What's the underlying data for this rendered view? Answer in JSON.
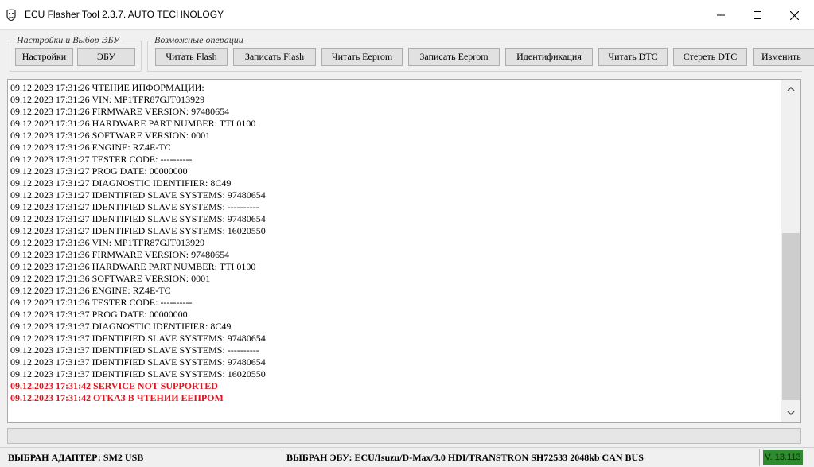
{
  "window": {
    "title": "ECU Flasher Tool 2.3.7. AUTO TECHNOLOGY"
  },
  "settings_group": {
    "legend": "Настройки и Выбор ЭБУ",
    "settings_label": "Настройки",
    "ecu_label": "ЭБУ"
  },
  "operations_group": {
    "legend": "Возможные операции",
    "buttons": [
      "Читать Flash",
      "Записать Flash",
      "Читать Eeprom",
      "Записать Eeprom",
      "Идентификация",
      "Читать DTC",
      "Стереть DTC",
      "Изменить"
    ]
  },
  "log": {
    "lines": [
      "09.12.2023 17:31:26 ЧТЕНИЕ ИНФОРМАЦИИ:",
      "09.12.2023 17:31:26 VIN: MP1TFR87GJT013929",
      "09.12.2023 17:31:26 FIRMWARE VERSION: 97480654",
      "09.12.2023 17:31:26 HARDWARE PART NUMBER: TTI  0100",
      "09.12.2023 17:31:26 SOFTWARE VERSION: 0001",
      "09.12.2023 17:31:26 ENGINE: RZ4E-TC",
      "09.12.2023 17:31:27 TESTER CODE: ----------",
      "09.12.2023 17:31:27 PROG DATE: 00000000",
      "09.12.2023 17:31:27 DIAGNOSTIC IDENTIFIER: 8C49",
      "09.12.2023 17:31:27 IDENTIFIED SLAVE SYSTEMS: 97480654",
      "09.12.2023 17:31:27 IDENTIFIED SLAVE SYSTEMS: ----------",
      "09.12.2023 17:31:27 IDENTIFIED SLAVE SYSTEMS: 97480654",
      "09.12.2023 17:31:27 IDENTIFIED SLAVE SYSTEMS: 16020550",
      "09.12.2023 17:31:36 VIN: MP1TFR87GJT013929",
      "09.12.2023 17:31:36 FIRMWARE VERSION: 97480654",
      "09.12.2023 17:31:36 HARDWARE PART NUMBER: TTI  0100",
      "09.12.2023 17:31:36 SOFTWARE VERSION: 0001",
      "09.12.2023 17:31:36 ENGINE: RZ4E-TC",
      "09.12.2023 17:31:36 TESTER CODE: ----------",
      "09.12.2023 17:31:37 PROG DATE: 00000000",
      "09.12.2023 17:31:37 DIAGNOSTIC IDENTIFIER: 8C49",
      "09.12.2023 17:31:37 IDENTIFIED SLAVE SYSTEMS: 97480654",
      "09.12.2023 17:31:37 IDENTIFIED SLAVE SYSTEMS: ----------",
      "09.12.2023 17:31:37 IDENTIFIED SLAVE SYSTEMS: 97480654",
      "09.12.2023 17:31:37 IDENTIFIED SLAVE SYSTEMS: 16020550"
    ],
    "error_lines": [
      "09.12.2023 17:31:42 SERVICE NOT SUPPORTED",
      "09.12.2023 17:31:42 ОТКАЗ В ЧТЕНИИ EEПРОМ"
    ],
    "error_color": "#e0141e"
  },
  "progress": {
    "value_percent": 0
  },
  "statusbar": {
    "adapter": "ВЫБРАН АДАПТЕР: SM2 USB",
    "ecu": "ВЫБРАН ЭБУ: ECU/Isuzu/D-Max/3.0 HDI/TRANSTRON SH72533 2048kb CAN BUS",
    "version": "V. 13.113",
    "version_color": "#2e8b2e"
  }
}
